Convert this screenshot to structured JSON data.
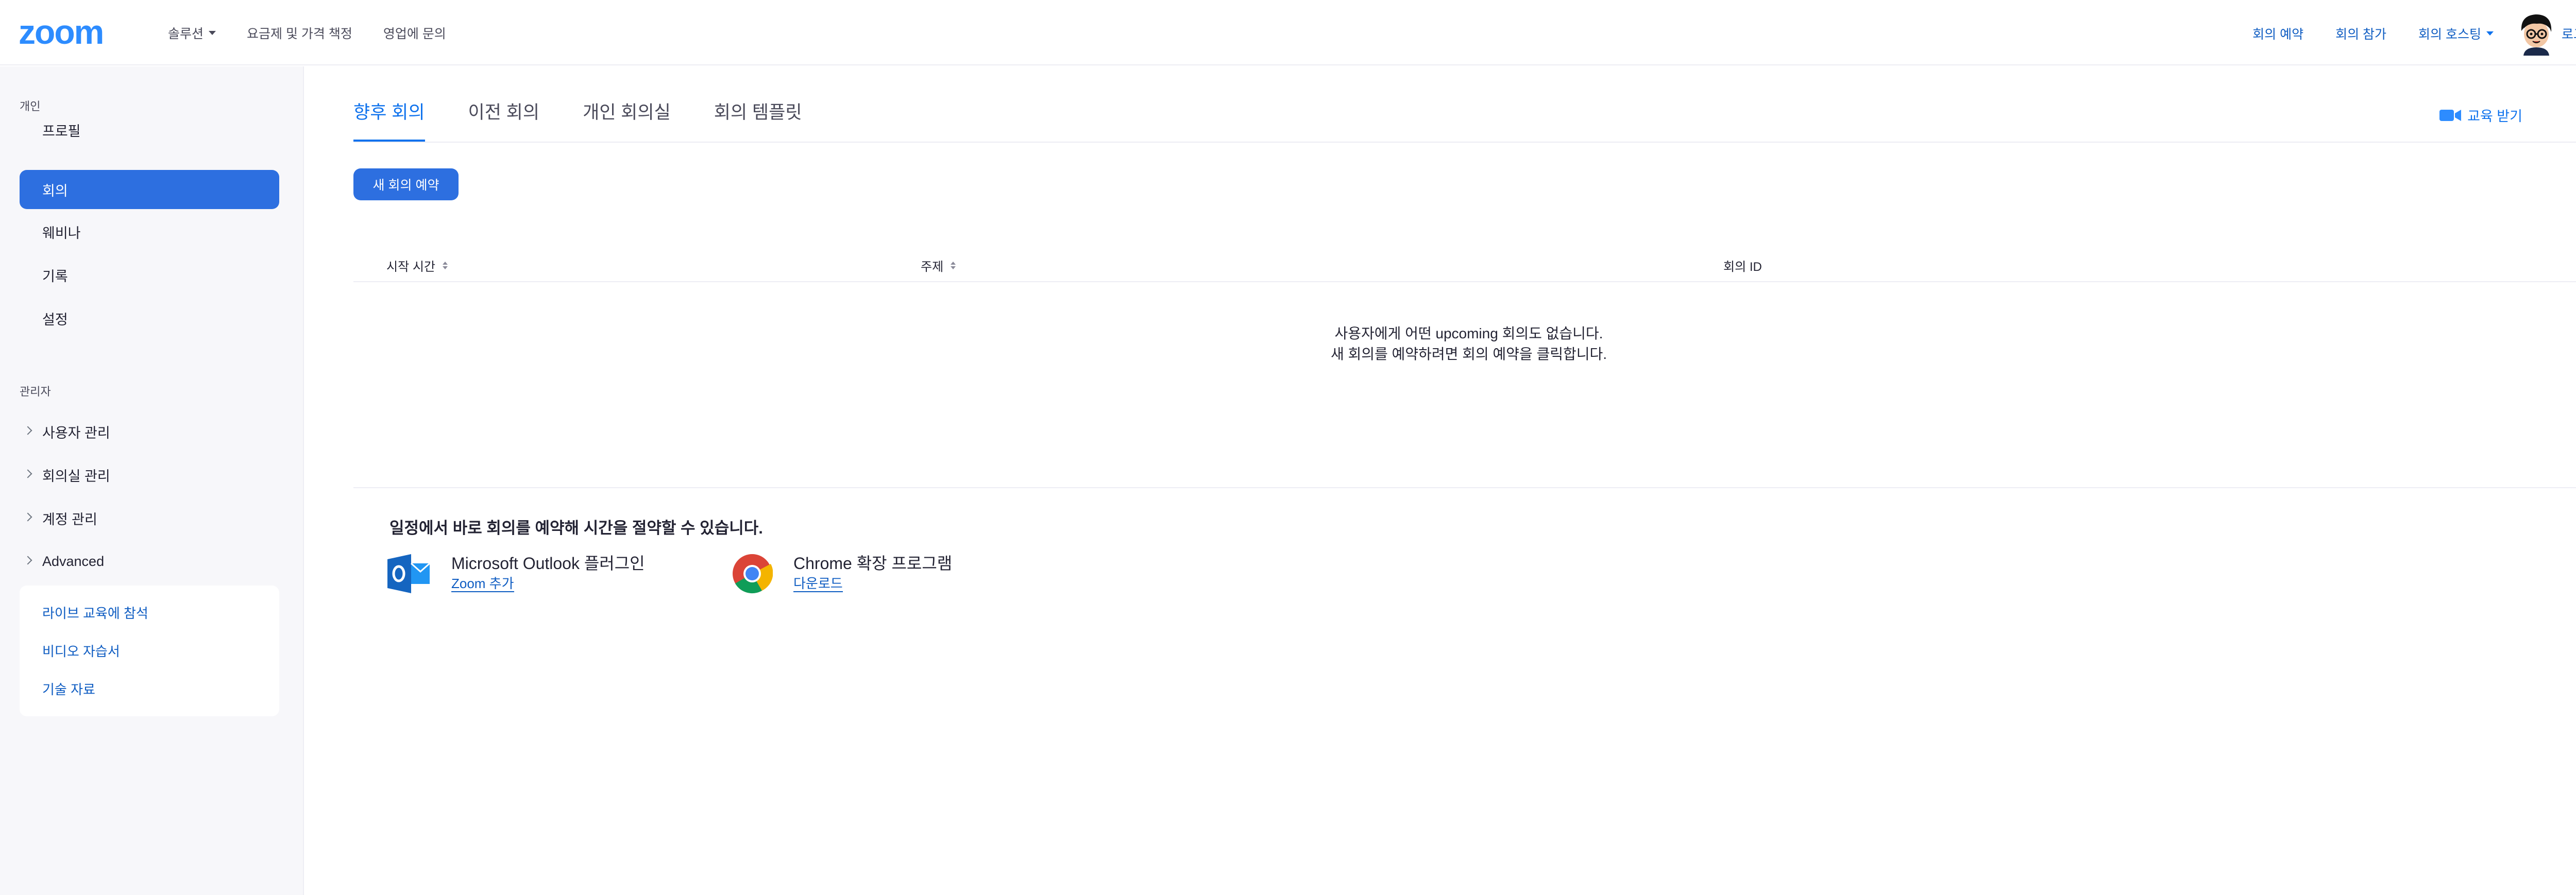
{
  "header": {
    "logo": "zoom",
    "left_nav": [
      {
        "label": "솔루션",
        "has_dropdown": true
      },
      {
        "label": "요금제 및 가격 책정",
        "has_dropdown": false
      },
      {
        "label": "영업에 문의",
        "has_dropdown": false
      }
    ],
    "right_nav": {
      "schedule": "회의 예약",
      "join": "회의 참가",
      "host": "회의 호스팅",
      "logout": "로그아웃"
    }
  },
  "sidebar": {
    "personal_label": "개인",
    "personal_items": [
      "프로필",
      "회의",
      "웨비나",
      "기록",
      "설정"
    ],
    "active_item": "회의",
    "admin_label": "관리자",
    "admin_items": [
      "사용자 관리",
      "회의실 관리",
      "계정 관리",
      "Advanced"
    ],
    "help_links": [
      "라이브 교육에 참석",
      "비디오 자습서",
      "기술 자료"
    ]
  },
  "main": {
    "tabs": [
      "향후 회의",
      "이전 회의",
      "개인 회의실",
      "회의 템플릿"
    ],
    "active_tab": "향후 회의",
    "training_label": "교육 받기",
    "schedule_button": "새 회의 예약",
    "table": {
      "columns": [
        "시작 시간",
        "주제",
        "회의 ID"
      ]
    },
    "empty_line1": "사용자에게 어떤 upcoming 회의도 없습니다.",
    "empty_line2": "새 회의를 예약하려면 회의 예약을 클릭합니다.",
    "promo_title": "일정에서 바로 회의를 예약해 시간을 절약할 수 있습니다.",
    "promos": [
      {
        "name": "Microsoft Outlook 플러그인",
        "link": "Zoom 추가",
        "icon": "outlook-icon"
      },
      {
        "name": "Chrome 확장 프로그램",
        "link": "다운로드",
        "icon": "chrome-icon"
      }
    ]
  },
  "colors": {
    "brand": "#2d8cff",
    "accent": "#0e72ed",
    "active_bg": "#2d6fe0",
    "sidebar_bg": "#f7f7fa"
  }
}
